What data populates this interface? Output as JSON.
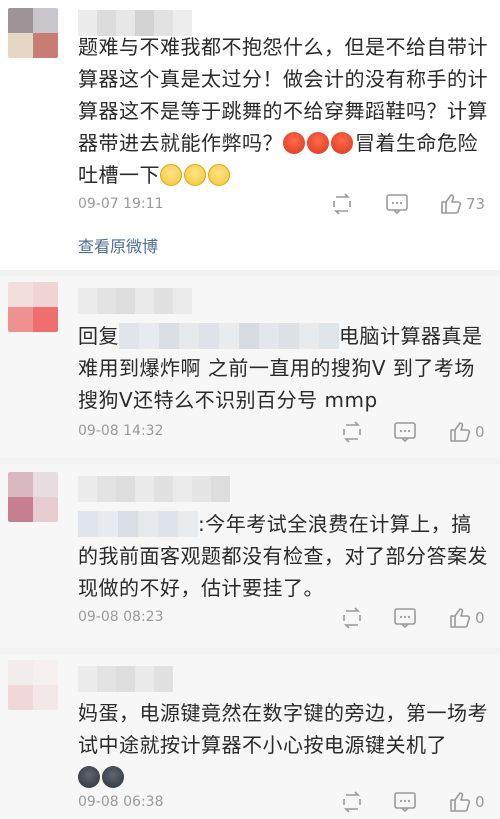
{
  "comments": [
    {
      "text": "题难与不难我都不抱怨什么，但是不给自带计算器这个真是太过分！做会计的没有称手的计算器这不是等于跳舞的不给穿舞蹈鞋吗？计算器带进去就能作弊吗？",
      "text_tail": "冒着生命危险吐槽一下",
      "time": "09-07 19:11",
      "likes": "73",
      "link": "查看原微博"
    },
    {
      "reply_prefix": "回复",
      "text": "电脑计算器真是难用到爆炸啊 之前一直用的搜狗V 到了考场搜狗V还特么不识别百分号 mmp",
      "time": "09-08 14:32",
      "likes": "0"
    },
    {
      "text": ":今年考试全浪费在计算上，搞的我前面客观题都没有检查，对了部分答案发现做的不好，估计要挂了。",
      "time": "09-08 08:23",
      "likes": "0"
    },
    {
      "text": "妈蛋，电源键竟然在数字键的旁边，第一场考试中途就按计算器不小心按电源键关机了",
      "time": "09-08 06:38",
      "likes": "0"
    }
  ],
  "icons": {
    "repost": "repost-icon",
    "comment": "comment-icon",
    "like": "thumbs-up-icon",
    "emoji_angry": "angry-face-icon",
    "emoji_sad": "sad-face-icon",
    "emoji_cry": "crying-face-icon"
  },
  "colors": {
    "link": "#4f6d96",
    "meta": "#9a9a9a",
    "text": "#2a2a2a"
  }
}
